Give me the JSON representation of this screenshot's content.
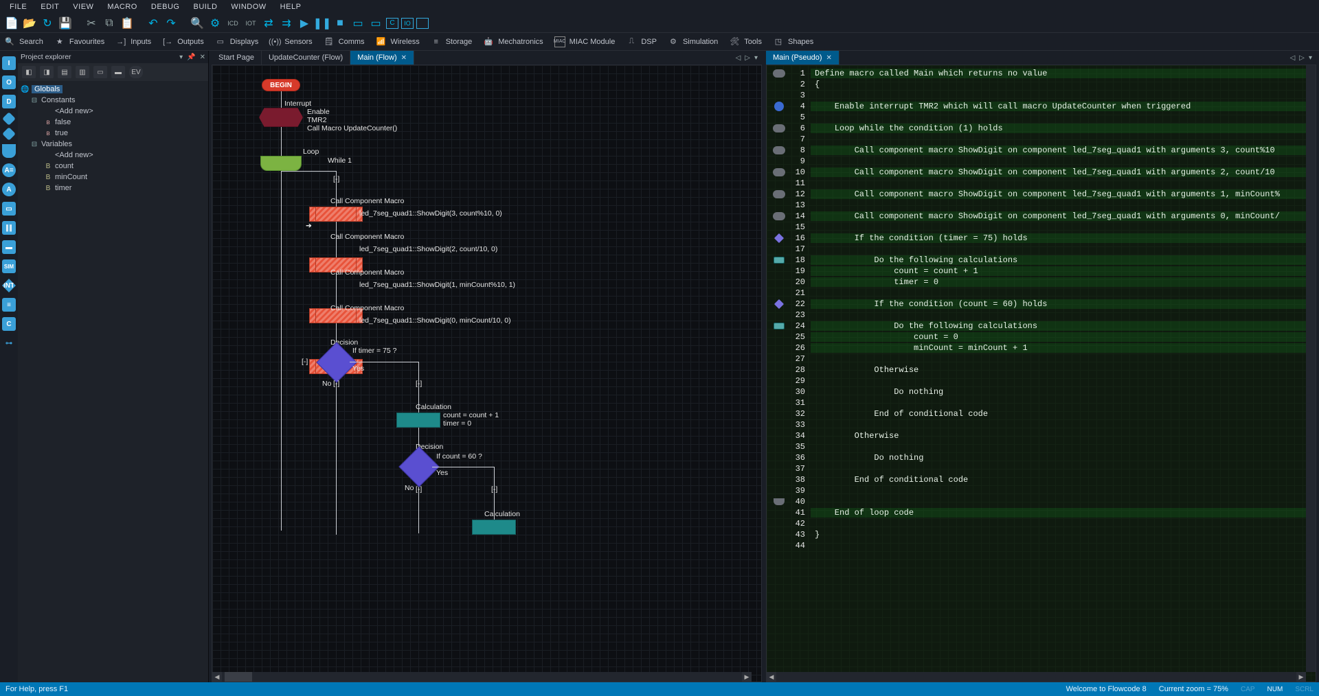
{
  "menu": [
    "FILE",
    "EDIT",
    "VIEW",
    "MACRO",
    "DEBUG",
    "BUILD",
    "WINDOW",
    "HELP"
  ],
  "categories": [
    "Search",
    "Favourites",
    "Inputs",
    "Outputs",
    "Displays",
    "Sensors",
    "Comms",
    "Wireless",
    "Storage",
    "Mechatronics",
    "MIAC Module",
    "DSP",
    "Simulation",
    "Tools",
    "Shapes"
  ],
  "panel": {
    "title": "Project explorer",
    "globals": "Globals",
    "constants_label": "Constants",
    "variables_label": "Variables",
    "addnew": "<Add new>",
    "const_false": "false",
    "const_true": "true",
    "var_count": "count",
    "var_minCount": "minCount",
    "var_timer": "timer"
  },
  "left_tabs": {
    "t0": "Start Page",
    "t1": "UpdateCounter (Flow)",
    "t2": "Main (Flow)"
  },
  "right_tabs": {
    "t0": "Main (Pseudo)"
  },
  "flow": {
    "begin": "BEGIN",
    "interrupt": "Interrupt",
    "int_l1": "Enable",
    "int_l2": "TMR2",
    "int_l3": "Call Macro UpdateCounter()",
    "loop": "Loop",
    "while1": "While 1",
    "ccm": "Call Component Macro",
    "m1": "led_7seg_quad1::ShowDigit(3, count%10, 0)",
    "m2": "led_7seg_quad1::ShowDigit(2, count/10, 0)",
    "m3": "led_7seg_quad1::ShowDigit(1, minCount%10, 1)",
    "m4": "led_7seg_quad1::ShowDigit(0, minCount/10, 0)",
    "decision": "Decision",
    "d1q": "If timer = 75 ?",
    "d2q": "If count = 60 ?",
    "yes": "Yes",
    "no": "No",
    "calc": "Calculation",
    "calc1a": "count = count + 1",
    "calc1b": "timer = 0",
    "conn": "[-]"
  },
  "pseudo": [
    {
      "n": 1,
      "g": "pill",
      "hl": true,
      "t": "Define macro called Main which returns no value"
    },
    {
      "n": 2,
      "g": "",
      "hl": false,
      "t": "{"
    },
    {
      "n": 3,
      "g": "",
      "hl": false,
      "t": ""
    },
    {
      "n": 4,
      "g": "int",
      "hl": true,
      "t": "    Enable interrupt TMR2 which will call macro UpdateCounter when triggered"
    },
    {
      "n": 5,
      "g": "",
      "hl": false,
      "t": ""
    },
    {
      "n": 6,
      "g": "pill",
      "hl": true,
      "t": "    Loop while the condition (1) holds"
    },
    {
      "n": 7,
      "g": "",
      "hl": false,
      "t": ""
    },
    {
      "n": 8,
      "g": "pill",
      "hl": true,
      "t": "        Call component macro ShowDigit on component led_7seg_quad1 with arguments 3, count%10"
    },
    {
      "n": 9,
      "g": "",
      "hl": false,
      "t": ""
    },
    {
      "n": 10,
      "g": "pill",
      "hl": true,
      "t": "        Call component macro ShowDigit on component led_7seg_quad1 with arguments 2, count/10"
    },
    {
      "n": 11,
      "g": "",
      "hl": false,
      "t": ""
    },
    {
      "n": 12,
      "g": "pill",
      "hl": true,
      "t": "        Call component macro ShowDigit on component led_7seg_quad1 with arguments 1, minCount%"
    },
    {
      "n": 13,
      "g": "",
      "hl": false,
      "t": ""
    },
    {
      "n": 14,
      "g": "pill",
      "hl": true,
      "t": "        Call component macro ShowDigit on component led_7seg_quad1 with arguments 0, minCount/"
    },
    {
      "n": 15,
      "g": "",
      "hl": false,
      "t": ""
    },
    {
      "n": 16,
      "g": "dia",
      "hl": true,
      "t": "        If the condition (timer = 75) holds"
    },
    {
      "n": 17,
      "g": "",
      "hl": false,
      "t": ""
    },
    {
      "n": 18,
      "g": "calc",
      "hl": true,
      "t": "            Do the following calculations"
    },
    {
      "n": 19,
      "g": "",
      "hl": true,
      "t": "                count = count + 1"
    },
    {
      "n": 20,
      "g": "",
      "hl": true,
      "t": "                timer = 0"
    },
    {
      "n": 21,
      "g": "",
      "hl": false,
      "t": ""
    },
    {
      "n": 22,
      "g": "dia",
      "hl": true,
      "t": "            If the condition (count = 60) holds"
    },
    {
      "n": 23,
      "g": "",
      "hl": false,
      "t": ""
    },
    {
      "n": 24,
      "g": "calc",
      "hl": true,
      "t": "                Do the following calculations"
    },
    {
      "n": 25,
      "g": "",
      "hl": true,
      "t": "                    count = 0"
    },
    {
      "n": 26,
      "g": "",
      "hl": true,
      "t": "                    minCount = minCount + 1"
    },
    {
      "n": 27,
      "g": "",
      "hl": false,
      "t": ""
    },
    {
      "n": 28,
      "g": "",
      "hl": false,
      "t": "            Otherwise"
    },
    {
      "n": 29,
      "g": "",
      "hl": false,
      "t": ""
    },
    {
      "n": 30,
      "g": "",
      "hl": false,
      "t": "                Do nothing"
    },
    {
      "n": 31,
      "g": "",
      "hl": false,
      "t": ""
    },
    {
      "n": 32,
      "g": "",
      "hl": false,
      "t": "            End of conditional code"
    },
    {
      "n": 33,
      "g": "",
      "hl": false,
      "t": ""
    },
    {
      "n": 34,
      "g": "",
      "hl": false,
      "t": "        Otherwise"
    },
    {
      "n": 35,
      "g": "",
      "hl": false,
      "t": ""
    },
    {
      "n": 36,
      "g": "",
      "hl": false,
      "t": "            Do nothing"
    },
    {
      "n": 37,
      "g": "",
      "hl": false,
      "t": ""
    },
    {
      "n": 38,
      "g": "",
      "hl": false,
      "t": "        End of conditional code"
    },
    {
      "n": 39,
      "g": "",
      "hl": false,
      "t": ""
    },
    {
      "n": 40,
      "g": "loopend",
      "hl": true,
      "t": ""
    },
    {
      "n": 41,
      "g": "",
      "hl": true,
      "t": "    End of loop code"
    },
    {
      "n": 42,
      "g": "",
      "hl": false,
      "t": ""
    },
    {
      "n": 43,
      "g": "",
      "hl": false,
      "t": "}"
    },
    {
      "n": 44,
      "g": "",
      "hl": false,
      "t": ""
    }
  ],
  "status": {
    "help": "For Help, press F1",
    "welcome": "Welcome to Flowcode 8",
    "zoom": "Current zoom = 75%",
    "cap": "CAP",
    "num": "NUM",
    "scrl": "SCRL"
  }
}
